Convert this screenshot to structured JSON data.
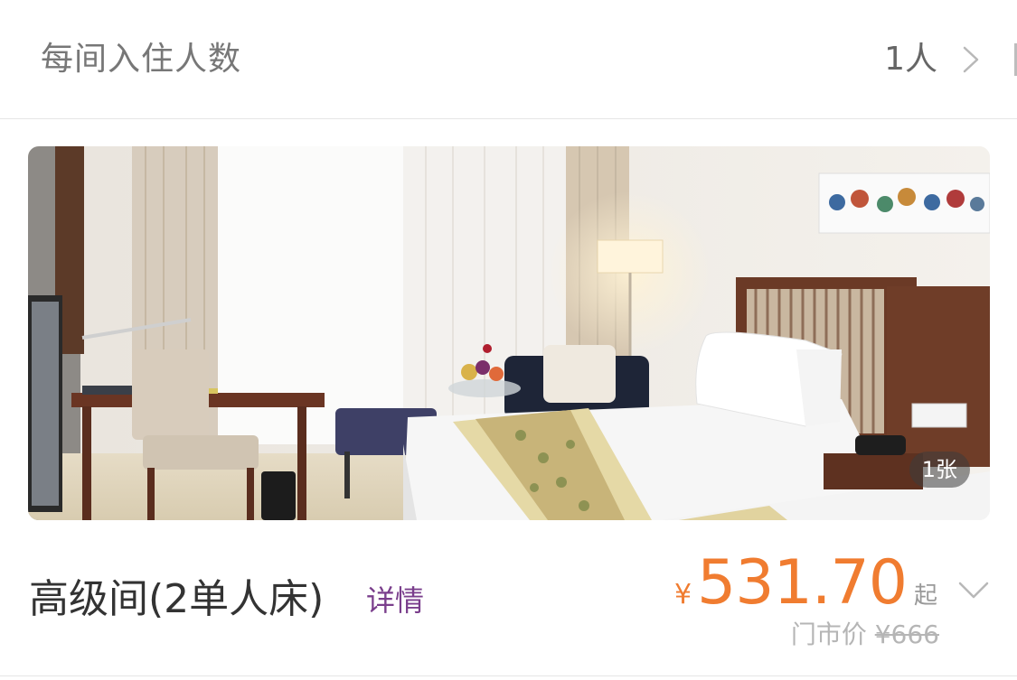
{
  "guests": {
    "label": "每间入住人数",
    "value": "1人"
  },
  "room": {
    "photo_count": "1张",
    "name": "高级间(2单人床)",
    "details_label": "详情",
    "currency": "¥",
    "price": "531.70",
    "price_suffix": "起",
    "market_label": "门市价",
    "market_price": "¥666"
  },
  "icons": {
    "guest_chevron": "chevron-right-icon",
    "expand": "chevron-down-icon"
  },
  "colors": {
    "price": "#f07c30",
    "details_link": "#7a3e8c"
  }
}
